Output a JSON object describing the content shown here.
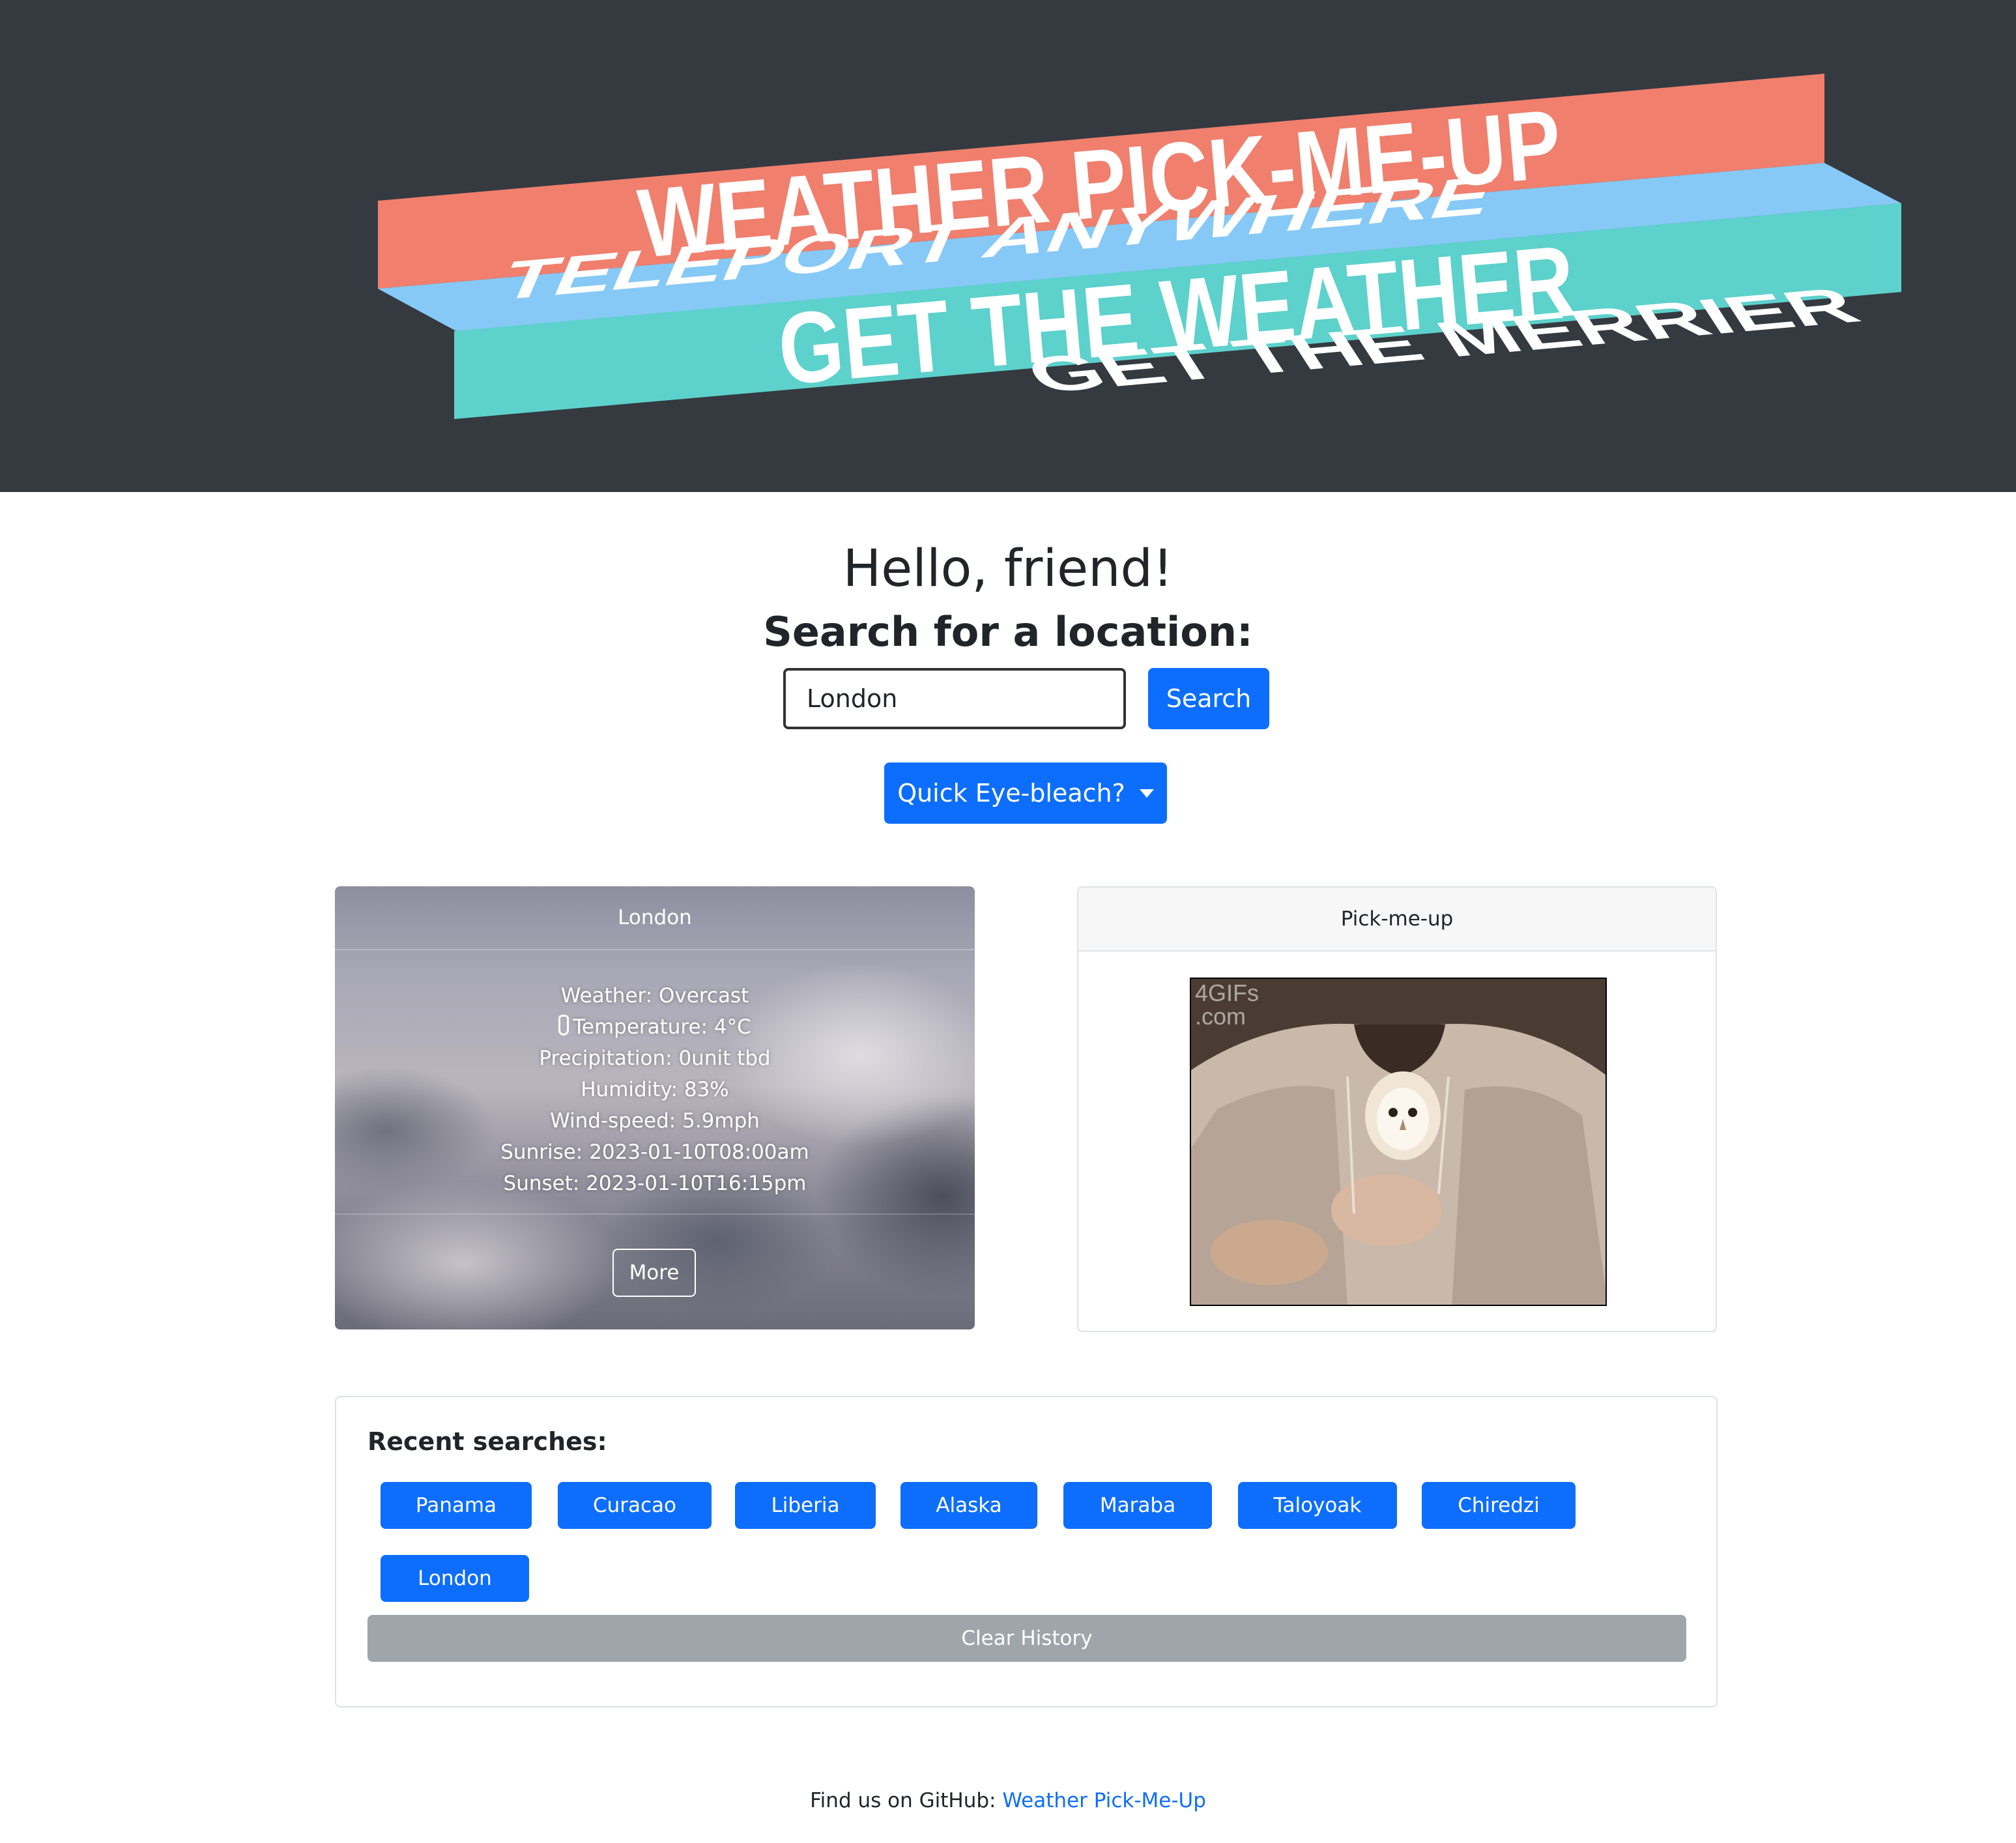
{
  "hero": {
    "line1": "WEATHER PICK-ME-UP",
    "line2": "TELEPORT ANYWHERE",
    "line3": "GET THE WEATHER",
    "line4": "GET THE MERRIER",
    "colors": {
      "background": "#343a40",
      "salmon": "#f07f6e",
      "lightblue": "#87c9f6",
      "teal": "#5dd1cc"
    }
  },
  "main": {
    "greeting": "Hello, friend!",
    "search_heading": "Search for a location:",
    "search_value": "London",
    "search_button": "Search",
    "eyebleach_button": "Quick Eye-bleach?"
  },
  "weather": {
    "city": "London",
    "lines": [
      "Weather: Overcast",
      "Temperature: 4°C",
      "Precipitation: 0unit tbd",
      "Humidity: 83%",
      "Wind-speed: 5.9mph",
      "Sunrise: 2023-01-10T08:00am",
      "Sunset: 2023-01-10T16:15pm"
    ],
    "more_button": "More"
  },
  "pickmeup": {
    "header": "Pick-me-up",
    "watermark": "4GIFs\n.com"
  },
  "recent": {
    "title": "Recent searches:",
    "items": [
      "Panama",
      "Curacao",
      "Liberia",
      "Alaska",
      "Maraba",
      "Taloyoak",
      "Chiredzi",
      "London"
    ],
    "clear_button": "Clear History"
  },
  "footer": {
    "text": "Find us on GitHub:",
    "link": "Weather Pick-Me-Up"
  },
  "colors": {
    "primary": "#0d6efd",
    "secondary": "#9ea5ab"
  }
}
